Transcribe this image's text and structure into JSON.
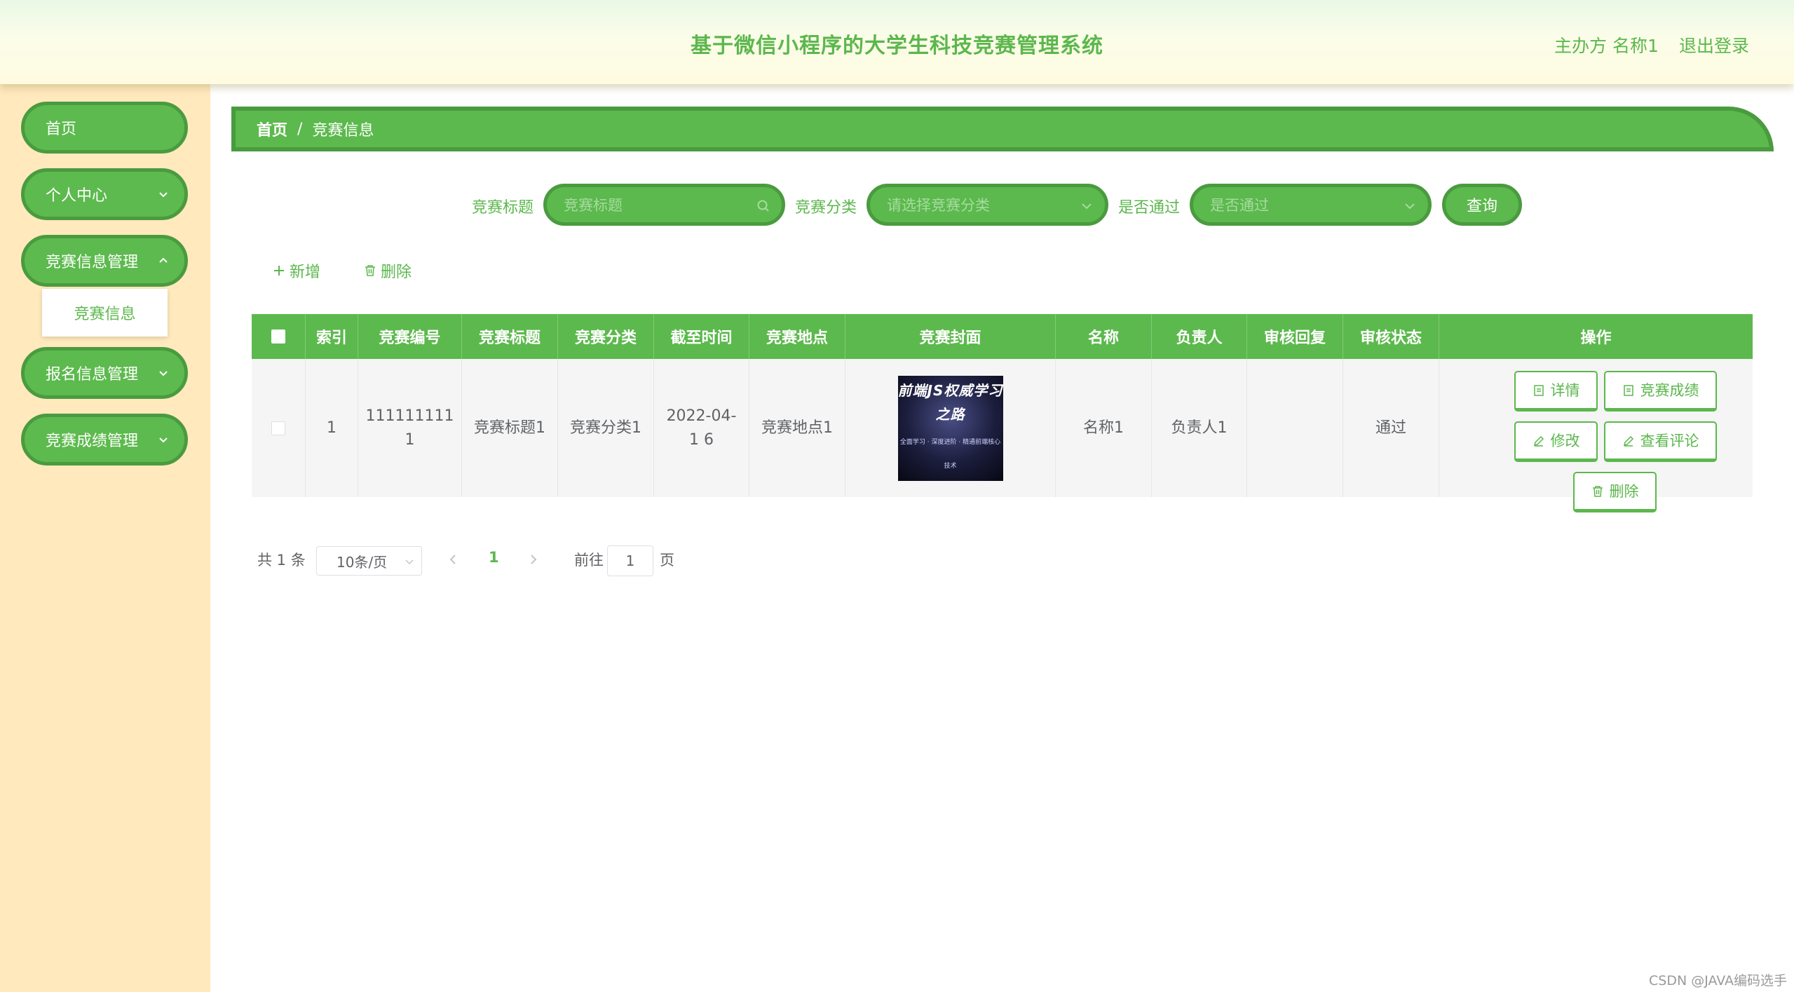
{
  "header": {
    "title": "基于微信小程序的大学生科技竞赛管理系统",
    "user": "主办方 名称1",
    "logout": "退出登录"
  },
  "sidebar": {
    "items": [
      {
        "label": "首页"
      },
      {
        "label": "个人中心"
      },
      {
        "label": "竞赛信息管理"
      },
      {
        "label": "报名信息管理"
      },
      {
        "label": "竞赛成绩管理"
      }
    ],
    "submenu_item": "竞赛信息"
  },
  "breadcrumb": {
    "home": "首页",
    "separator": "/",
    "current": "竞赛信息"
  },
  "search": {
    "title_label": "竞赛标题",
    "title_placeholder": "竞赛标题",
    "category_label": "竞赛分类",
    "category_placeholder": "请选择竞赛分类",
    "pass_label": "是否通过",
    "pass_placeholder": "是否通过",
    "query_button": "查询"
  },
  "actions": {
    "add": "新增",
    "delete": "删除"
  },
  "table": {
    "headers": [
      "索引",
      "竞赛编号",
      "竞赛标题",
      "竞赛分类",
      "截至时间",
      "竞赛地点",
      "竞赛封面",
      "名称",
      "负责人",
      "审核回复",
      "审核状态",
      "操作"
    ],
    "rows": [
      {
        "index": "1",
        "number": "111111111 1",
        "title": "竞赛标题1",
        "category": "竞赛分类1",
        "deadline": "2022-04-1 6",
        "location": "竞赛地点1",
        "cover_title": "前端JS权威学习之路",
        "cover_subtitle": "全面学习 · 深度进阶 · 精通前端核心技术",
        "name": "名称1",
        "owner": "负责人1",
        "reply": "",
        "status": "通过",
        "ops": {
          "detail": "详情",
          "score": "竞赛成绩",
          "edit": "修改",
          "comments": "查看评论",
          "delete": "删除"
        }
      }
    ]
  },
  "pagination": {
    "total": "共 1 条",
    "page_size": "10条/页",
    "current_page": "1",
    "goto_label": "前往",
    "goto_value": "1",
    "page_suffix": "页"
  },
  "watermark": "CSDN @JAVA编码选手",
  "colors": {
    "primary": "#5cb94d",
    "border": "#4a9b3f",
    "sidebar_bg": "#ffe9bd"
  }
}
